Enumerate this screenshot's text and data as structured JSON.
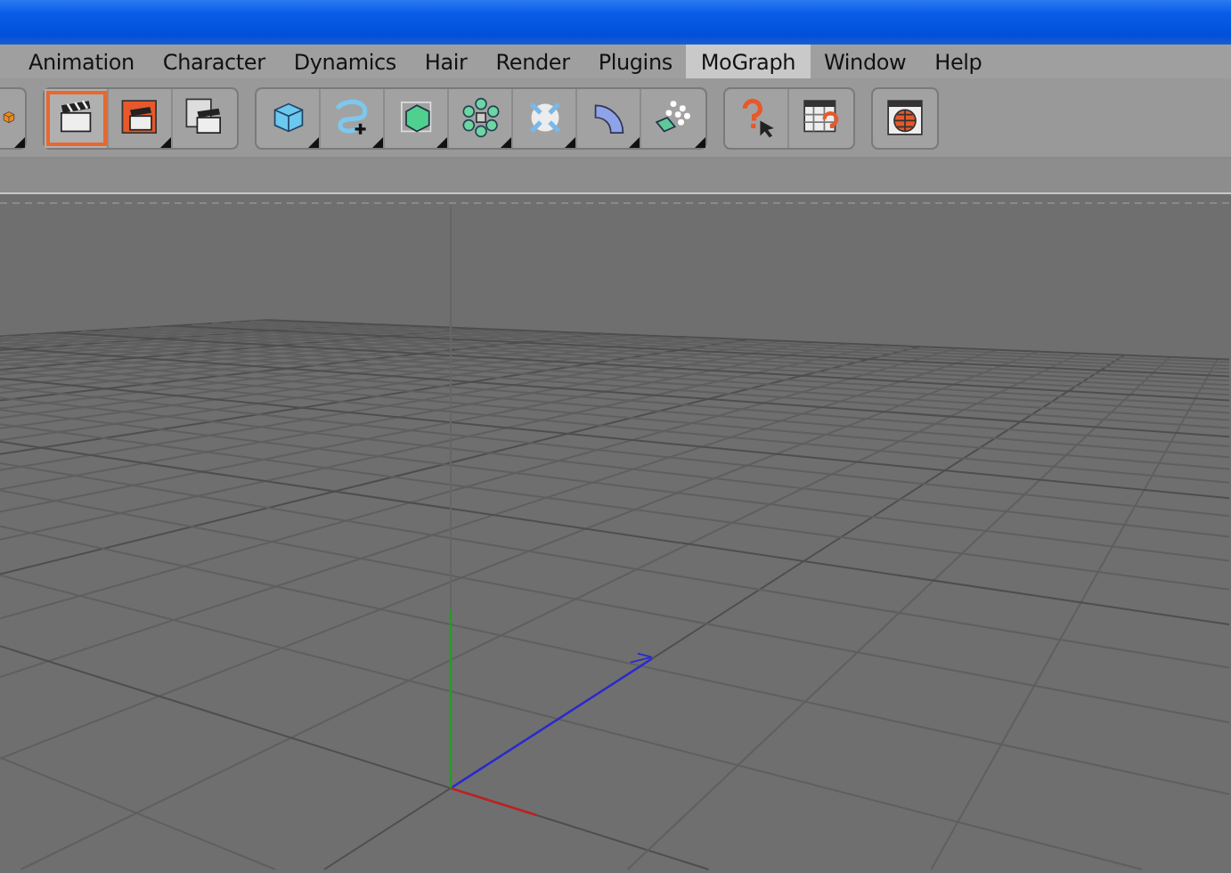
{
  "menu_bar": {
    "items": [
      {
        "label": "Animation",
        "selected": false
      },
      {
        "label": "Character",
        "selected": false
      },
      {
        "label": "Dynamics",
        "selected": false
      },
      {
        "label": "Hair",
        "selected": false
      },
      {
        "label": "Render",
        "selected": false
      },
      {
        "label": "Plugins",
        "selected": false
      },
      {
        "label": "MoGraph",
        "selected": true
      },
      {
        "label": "Window",
        "selected": false
      },
      {
        "label": "Help",
        "selected": false
      }
    ]
  },
  "toolbar": {
    "groups": [
      {
        "buttons": [
          {
            "active": false,
            "submenu": true
          }
        ]
      },
      {
        "buttons": [
          {
            "active": true,
            "submenu": false
          },
          {
            "active": false,
            "submenu": true
          },
          {
            "active": false,
            "submenu": false
          }
        ]
      },
      {
        "buttons": [
          {
            "active": false,
            "submenu": true
          },
          {
            "active": false,
            "submenu": true
          },
          {
            "active": false,
            "submenu": true
          },
          {
            "active": false,
            "submenu": true
          },
          {
            "active": false,
            "submenu": true
          },
          {
            "active": false,
            "submenu": true
          },
          {
            "active": false,
            "submenu": true
          }
        ]
      },
      {
        "buttons": [
          {
            "active": false,
            "submenu": false
          },
          {
            "active": false,
            "submenu": false
          }
        ]
      },
      {
        "buttons": [
          {
            "active": false,
            "submenu": false
          }
        ]
      }
    ]
  }
}
